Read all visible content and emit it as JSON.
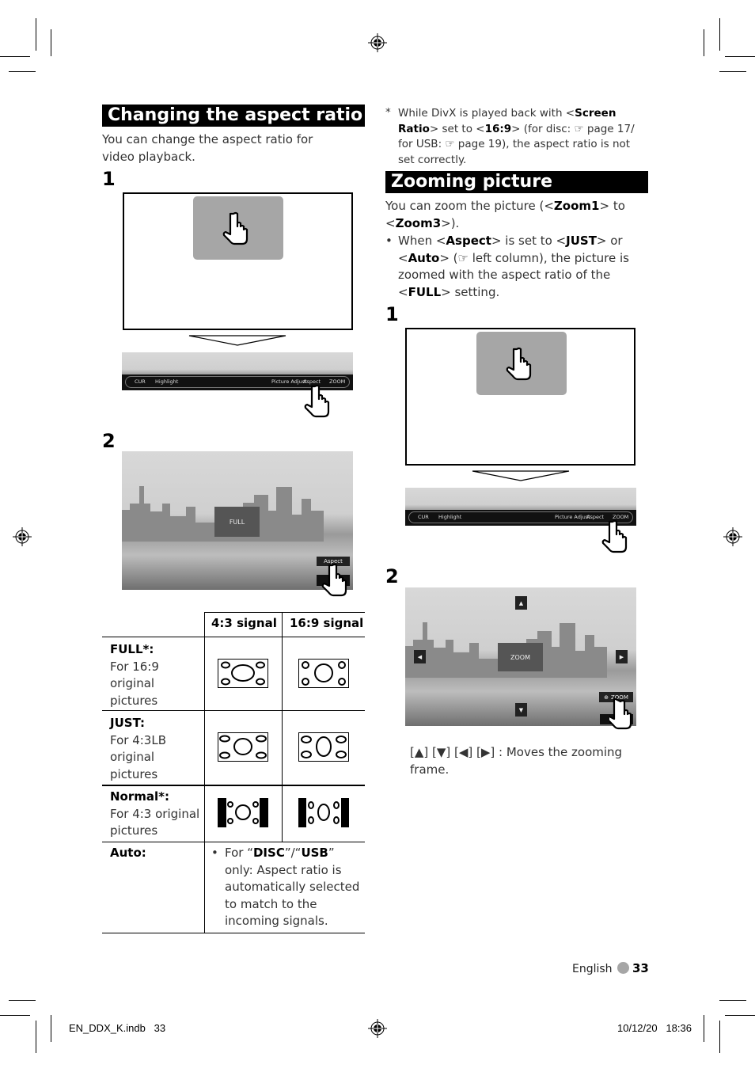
{
  "left": {
    "section_title": "Changing the aspect ratio",
    "intro": "You can change the aspect ratio for video playback.",
    "step1_label": "1",
    "step2_label": "2",
    "control_bar": [
      "CUR",
      "Highlight",
      "Picture Adjust",
      "Aspect",
      "ZOOM"
    ],
    "step2_overlay": "FULL",
    "step2_button": "Aspect",
    "table": {
      "headers": [
        "",
        "4:3 signal",
        "16:9 signal"
      ],
      "rows": [
        {
          "mode": "FULL*:",
          "desc": "For 16:9 original pictures",
          "icon_43": "full-43-diagram",
          "icon_169": "full-169-diagram"
        },
        {
          "mode": "JUST:",
          "desc": "For 4:3LB original pictures",
          "icon_43": "just-43-diagram",
          "icon_169": "just-169-diagram"
        },
        {
          "mode": "Normal*:",
          "desc": "For 4:3 original pictures",
          "icon_43": "normal-43-diagram",
          "icon_169": "normal-169-diagram"
        },
        {
          "mode": "Auto:",
          "desc_pre": "For “",
          "disc": "DISC",
          "mid": "”/“",
          "usb": "USB",
          "desc_post": "” only: Aspect ratio is automatically selected to match to the incoming signals."
        }
      ]
    }
  },
  "right": {
    "note_mark": "*",
    "note": {
      "t1": "While DivX is played back with <",
      "b1": "Screen Ratio",
      "t2": "> set to <",
      "b2": "16:9",
      "t3": "> (for disc: ☞ page 17/ for USB: ☞ page 19), the aspect ratio is not set correctly."
    },
    "section_title": "Zooming picture",
    "intro": {
      "t1": "You can zoom the picture (<",
      "b1": "Zoom1",
      "t2": "> to <",
      "b2": "Zoom3",
      "t3": ">)."
    },
    "bullet": {
      "t1": "When <",
      "b1": "Aspect",
      "t2": "> is set to <",
      "b2": "JUST",
      "t3": "> or <",
      "b3": "Auto",
      "t4": "> (☞ left column), the picture is zoomed with the aspect ratio of the <",
      "b4": "FULL",
      "t5": "> setting."
    },
    "step1_label": "1",
    "step2_label": "2",
    "control_bar": [
      "CUR",
      "Highlight",
      "Picture Adjust",
      "Aspect",
      "ZOOM"
    ],
    "step2_overlay": "ZOOM",
    "step2_button": "ZOOM",
    "arrows": [
      "▲",
      "▼",
      "◀",
      "▶"
    ],
    "caption": "[▲] [▼] [◀] [▶] : Moves the zooming frame."
  },
  "footer": {
    "language": "English",
    "page_number": "33",
    "file_info": "EN_DDX_K.indb   33",
    "timestamp": "10/12/20   18:36"
  }
}
